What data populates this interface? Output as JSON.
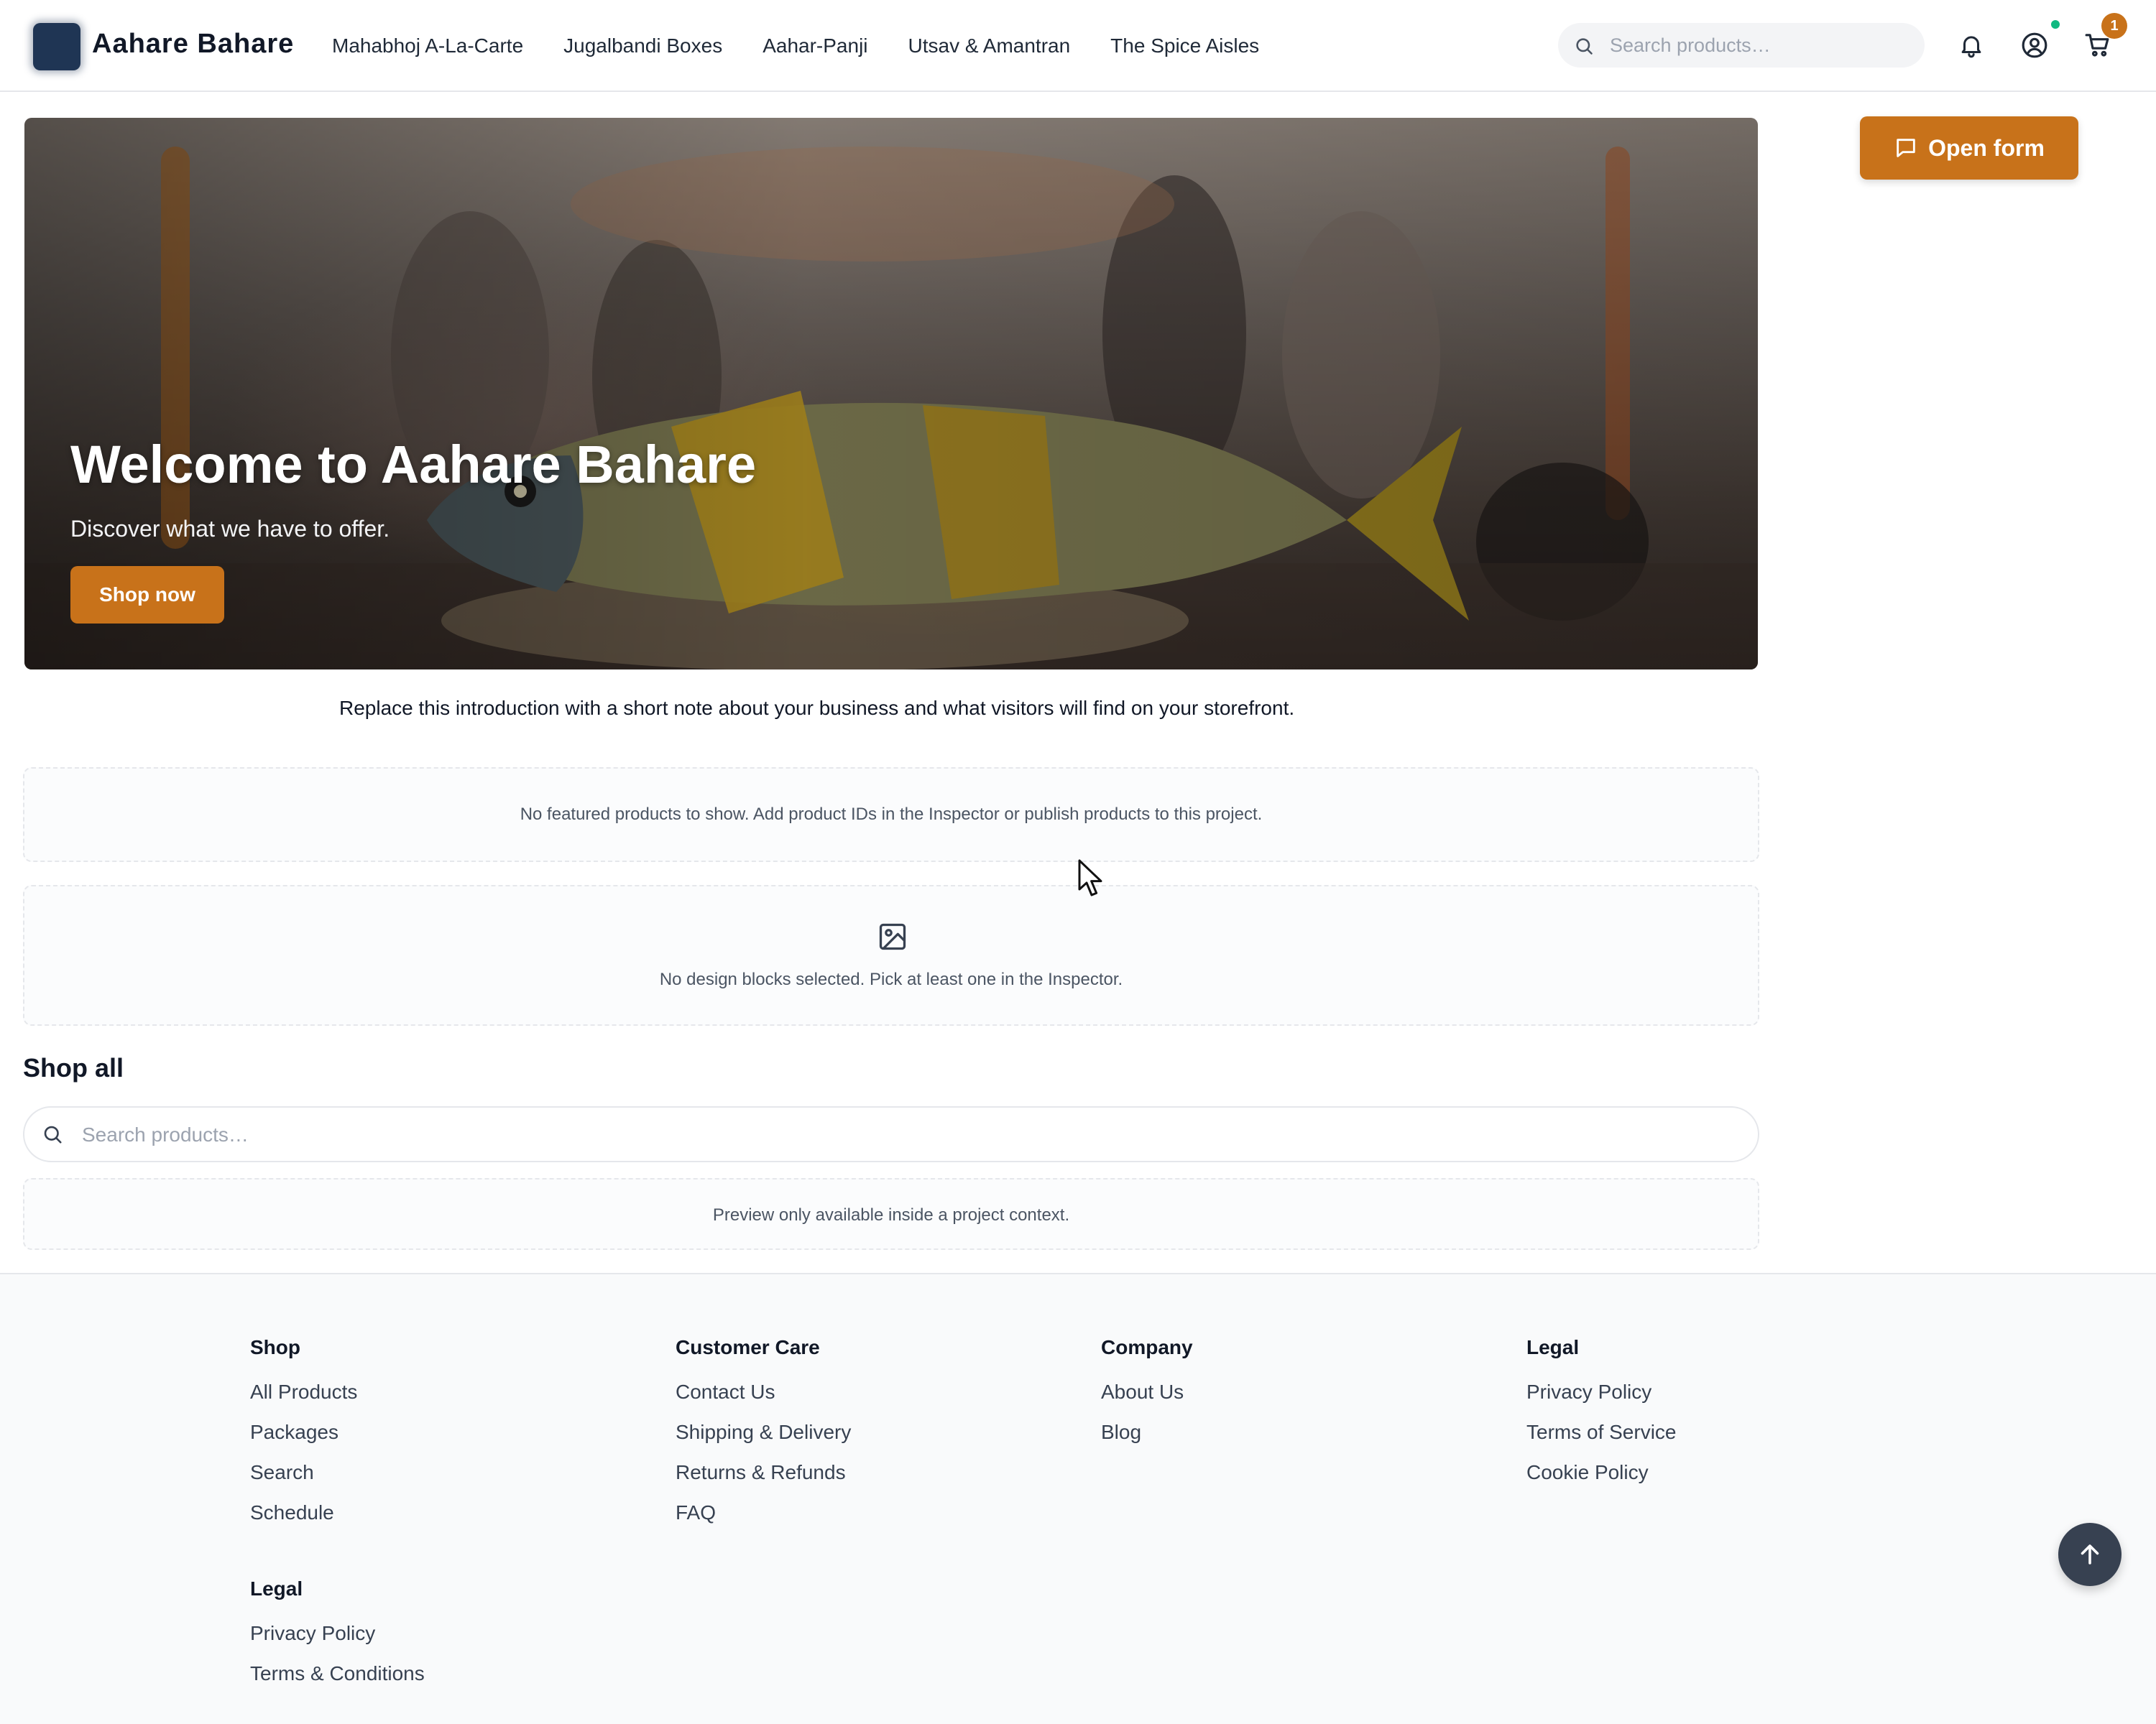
{
  "header": {
    "brand": "Aahare Bahare",
    "nav": [
      {
        "label": "Mahabhoj A-La-Carte"
      },
      {
        "label": "Jugalbandi Boxes"
      },
      {
        "label": "Aahar-Panji"
      },
      {
        "label": "Utsav & Amantran"
      },
      {
        "label": "The Spice Aisles"
      }
    ],
    "search_placeholder": "Search products…",
    "cart_count": "1",
    "icons": [
      "bell-icon",
      "user-circle-icon",
      "cart-icon"
    ]
  },
  "hero": {
    "title": "Welcome to Aahare Bahare",
    "subtitle": "Discover what we have to offer.",
    "button": "Shop now"
  },
  "open_form_label": "Open form",
  "intro": "Replace this introduction with a short note about your business and what visitors will find on your storefront.",
  "featured_empty": "No featured products to show. Add product IDs in the Inspector or publish products to this project.",
  "design_blocks_empty": "No design blocks selected. Pick at least one in the Inspector.",
  "shop_all": {
    "title": "Shop all",
    "search_placeholder": "Search products…",
    "preview_note": "Preview only available inside a project context."
  },
  "footer": {
    "columns": [
      {
        "heading": "Shop",
        "links": [
          "All Products",
          "Packages",
          "Search",
          "Schedule"
        ]
      },
      {
        "heading": "Customer Care",
        "links": [
          "Contact Us",
          "Shipping & Delivery",
          "Returns & Refunds",
          "FAQ"
        ]
      },
      {
        "heading": "Company",
        "links": [
          "About Us",
          "Blog"
        ]
      },
      {
        "heading": "Legal",
        "links": [
          "Privacy Policy",
          "Terms of Service",
          "Cookie Policy"
        ]
      }
    ],
    "extra_column": {
      "heading": "Legal",
      "links": [
        "Privacy Policy",
        "Terms & Conditions"
      ]
    }
  },
  "colors": {
    "accent": "#c8721a",
    "online": "#10b981",
    "dark_button": "#374151"
  }
}
